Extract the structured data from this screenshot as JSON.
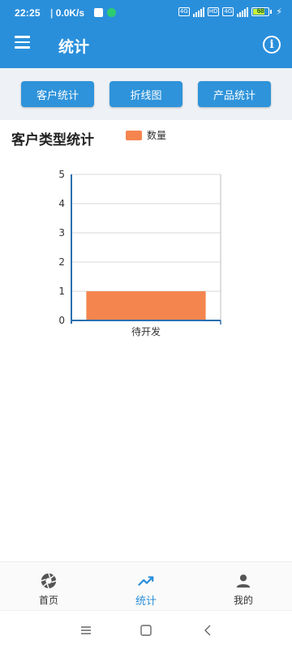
{
  "status_bar": {
    "time": "22:25",
    "speed": "0.0K/s",
    "net1": "4G",
    "net2": "HD",
    "net3": "4G",
    "battery": "68"
  },
  "header": {
    "title": "统计",
    "menu_icon": "hamburger-menu-icon",
    "info_icon": "info-icon"
  },
  "tabs": [
    {
      "label": "客户统计"
    },
    {
      "label": "折线图"
    },
    {
      "label": "产品统计"
    }
  ],
  "section": {
    "title": "客户类型统计",
    "legend": "数量",
    "accent": "#f5854f"
  },
  "chart_data": {
    "type": "bar",
    "categories": [
      "待开发"
    ],
    "series": [
      {
        "name": "数量",
        "values": [
          1
        ]
      }
    ],
    "title": "客户类型统计",
    "xlabel": "",
    "ylabel": "",
    "ylim": [
      0,
      5
    ],
    "yticks": [
      "0",
      "1",
      "2",
      "3",
      "4",
      "5"
    ],
    "grid": true,
    "legend": "top",
    "color": "#f5854f"
  },
  "bottom_nav": {
    "items": [
      {
        "label": "首页",
        "icon": "aperture-icon"
      },
      {
        "label": "统计",
        "icon": "trending-up-icon"
      },
      {
        "label": "我的",
        "icon": "person-icon"
      }
    ],
    "active": "统计",
    "active_color": "#2a8fdb"
  },
  "system_nav": {
    "icons": [
      "recents-icon",
      "home-icon",
      "back-icon"
    ]
  },
  "colors": {
    "primary": "#2a8fdb",
    "tab_button": "#2e93da",
    "tab_bar_bg": "#eef2f6"
  }
}
